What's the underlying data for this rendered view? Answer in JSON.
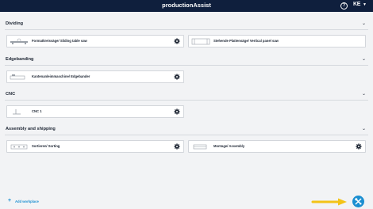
{
  "header": {
    "title": "productionAssist",
    "brand": "KE"
  },
  "sections": [
    {
      "title": "Dividing",
      "items": [
        {
          "label": "Formatkreissäge/ Sliding table saw"
        },
        {
          "label": "Stehende Plattensäge/ Vertical panel saw"
        }
      ]
    },
    {
      "title": "Edgebanding",
      "items": [
        {
          "label": "Kantenanleimmaschine/ Edgebander"
        }
      ]
    },
    {
      "title": "CNC",
      "items": [
        {
          "label": "CNC 1"
        }
      ]
    },
    {
      "title": "Assembly and shipping",
      "items": [
        {
          "label": "Sortieren/ Sorting"
        },
        {
          "label": "Montage/ Assembly"
        }
      ]
    }
  ],
  "footer": {
    "add_label": "Add workplace"
  },
  "colors": {
    "topbar": "#0f1f3d",
    "accent": "#1c8fd1",
    "arrow": "#f3c317"
  },
  "icons": [
    "help-icon",
    "chevron-down-icon",
    "gear-icon",
    "plus-icon",
    "tools-icon",
    "arrow-icon"
  ]
}
